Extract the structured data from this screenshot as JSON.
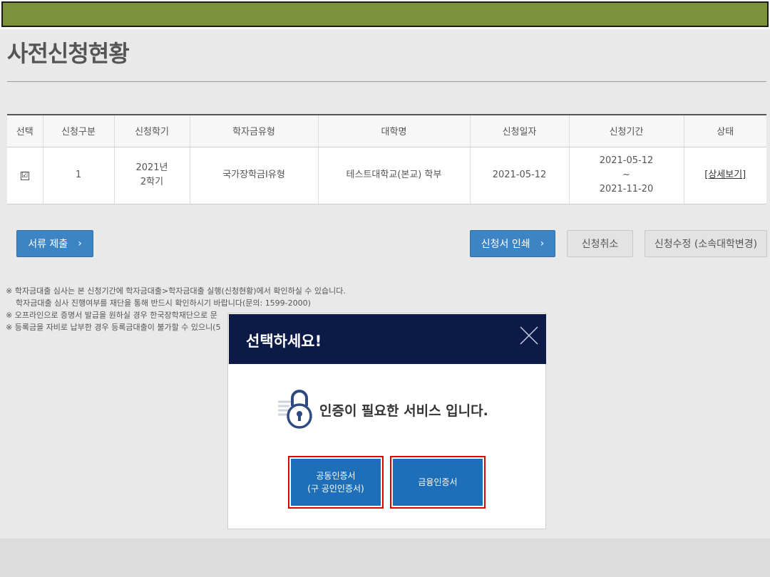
{
  "page": {
    "title": "사전신청현황"
  },
  "table": {
    "headers": [
      "선택",
      "신청구분",
      "신청학기",
      "학자금유형",
      "대학명",
      "신청일자",
      "신청기간",
      "상태"
    ],
    "row": {
      "checked": "☑",
      "type": "1",
      "semester_year": "2021년",
      "semester_term": "2학기",
      "loan_type": "국가장학금I유형",
      "university": "테스트대학교(본교) 학부",
      "apply_date": "2021-05-12",
      "period_start": "2021-05-12",
      "period_sep": "~",
      "period_end": "2021-11-20",
      "status": "[상세보기]"
    }
  },
  "buttons": {
    "submit_docs": "서류 제출",
    "print_application": "신청서 인쇄",
    "cancel_application": "신청취소",
    "modify_application": "신청수정 (소속대학변경)",
    "chevron": "›"
  },
  "notes": [
    "※ 학자금대출 심사는 본 신청기간에 학자금대출>학자금대출 실행(신청현황)에서 확인하실 수 있습니다.",
    "학자금대출 심사 진행여부를 재단을 통해 반드시 확인하시기 바랍니다(문의: 1599-2000)",
    "※ 오프라인으로 증명서 발급을 원하실 경우 한국장학재단으로 문",
    "※ 등록금을 자비로 납부한 경우 등록금대출이 불가할 수 있으니(5"
  ],
  "modal": {
    "title": "선택하세요!",
    "message": "인증이 필요한 서비스 입니다.",
    "cert_public_line1": "공동인증서",
    "cert_public_line2": "(구 공인인증서)",
    "cert_financial": "금융인증서",
    "icon": "lock-icon"
  },
  "colors": {
    "topbar": "#7b923a",
    "modal_header": "#0c1a48",
    "primary_button": "#3d84c4",
    "cert_button": "#1e6fb8",
    "highlight_border": "#e00000"
  }
}
